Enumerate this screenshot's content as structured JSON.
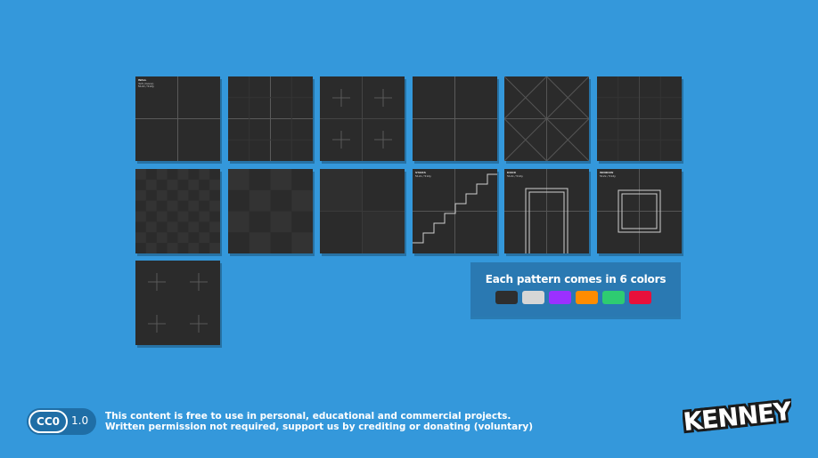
{
  "tiles": {
    "wall": {
      "name": "WALL",
      "line2": "3x3 (mono)",
      "line3": "512x / 512y"
    },
    "stairs": {
      "name": "STAIRS",
      "line2": "512x / 512y"
    },
    "door": {
      "name": "DOOR",
      "line2": "512x / 512y"
    },
    "window": {
      "name": "WINDOW",
      "line2": "512x / 512y"
    }
  },
  "palette": {
    "title": "Each pattern comes in 6 colors",
    "colors": [
      "#2e2e2e",
      "#d6d6d6",
      "#9b30ff",
      "#ff8c00",
      "#2ecc71",
      "#e8103b"
    ]
  },
  "license": {
    "badge": "CC0",
    "version": "1.0",
    "line1": "This content is free to use in personal, educational and commercial projects.",
    "line2": "Written permission not required, support us by crediting or donating (voluntary)"
  },
  "brand": {
    "logo_text": "KENNEY"
  }
}
